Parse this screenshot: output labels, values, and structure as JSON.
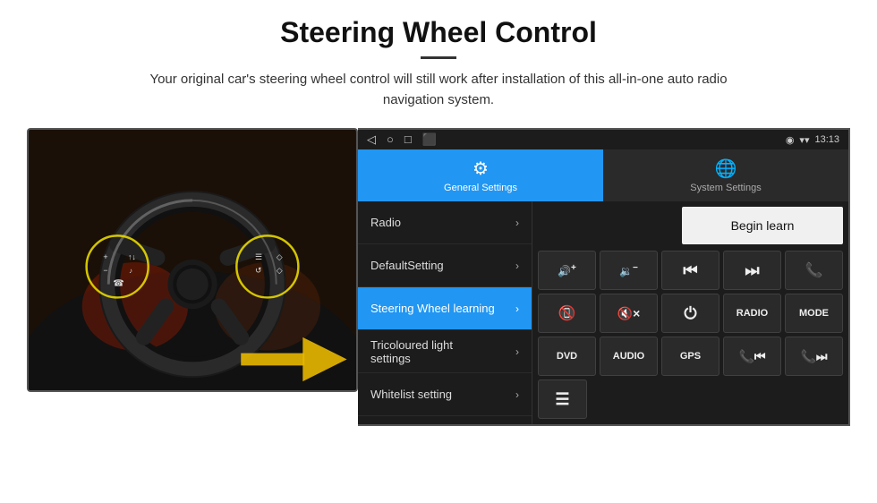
{
  "header": {
    "title": "Steering Wheel Control",
    "subtitle": "Your original car's steering wheel control will still work after installation of this all-in-one auto radio navigation system."
  },
  "statusBar": {
    "time": "13:13",
    "icons": [
      "◁",
      "○",
      "□",
      "⬛"
    ]
  },
  "navTabs": [
    {
      "id": "general",
      "label": "General Settings",
      "active": true
    },
    {
      "id": "system",
      "label": "System Settings",
      "active": false
    }
  ],
  "menuItems": [
    {
      "id": "radio",
      "label": "Radio",
      "active": false
    },
    {
      "id": "default",
      "label": "DefaultSetting",
      "active": false
    },
    {
      "id": "steering",
      "label": "Steering Wheel learning",
      "active": true
    },
    {
      "id": "tricoloured",
      "label": "Tricoloured light settings",
      "active": false
    },
    {
      "id": "whitelist",
      "label": "Whitelist setting",
      "active": false
    }
  ],
  "beginLearnBtn": "Begin learn",
  "controlRows": [
    [
      {
        "id": "vol-up",
        "icon": "🔊+",
        "label": "VOL+"
      },
      {
        "id": "vol-down",
        "icon": "🔉−",
        "label": "VOL-"
      },
      {
        "id": "prev-track",
        "icon": "⏮",
        "label": "PREV"
      },
      {
        "id": "next-track",
        "icon": "⏭",
        "label": "NEXT"
      },
      {
        "id": "phone",
        "icon": "📞",
        "label": "CALL"
      }
    ],
    [
      {
        "id": "hang-up",
        "icon": "📵",
        "label": "END"
      },
      {
        "id": "mute",
        "icon": "🔇x",
        "label": "MUTE"
      },
      {
        "id": "power",
        "icon": "⏻",
        "label": "PWR"
      },
      {
        "id": "radio-btn",
        "icon": "",
        "label": "RADIO"
      },
      {
        "id": "mode",
        "icon": "",
        "label": "MODE"
      }
    ],
    [
      {
        "id": "dvd",
        "icon": "",
        "label": "DVD"
      },
      {
        "id": "audio",
        "icon": "",
        "label": "AUDIO"
      },
      {
        "id": "gps",
        "icon": "",
        "label": "GPS"
      },
      {
        "id": "prev-combo",
        "icon": "📞⏮",
        "label": "TEL+PREV"
      },
      {
        "id": "next-combo",
        "icon": "📞⏭",
        "label": "TEL+NEXT"
      }
    ]
  ],
  "bottomIcon": "☰"
}
